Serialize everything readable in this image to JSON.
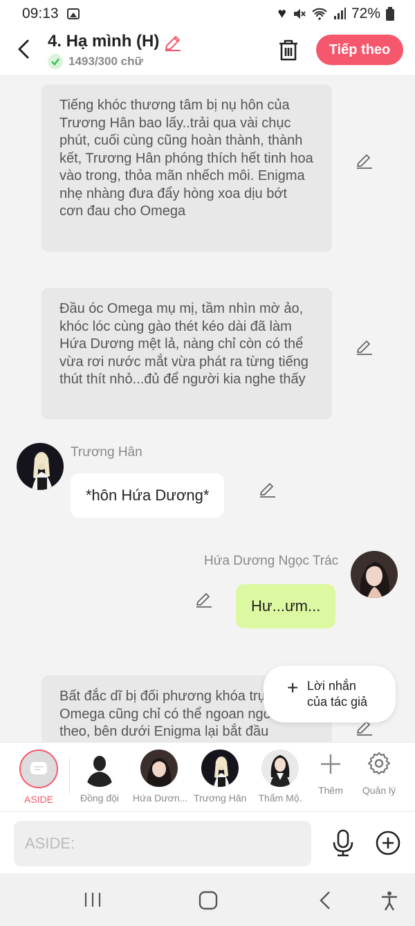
{
  "status_bar": {
    "time": "09:13",
    "battery": "72%",
    "icons": [
      "image-icon",
      "heart-icon",
      "mute-icon",
      "wifi-icon",
      "signal-icon",
      "battery-icon"
    ]
  },
  "header": {
    "title": "4. Hạ mình (H)",
    "word_count": "1493/300 chữ",
    "next_button": "Tiếp theo"
  },
  "chat": {
    "narration_1": "Tiếng khóc thương tâm bị nụ hôn của Trương Hân bao lấy..trải qua vài chục phút, cuối cùng cũng hoàn thành, thành kết, Trương Hân phóng thích hết tinh hoa vào trong, thỏa mãn nhếch môi. Enigma nhẹ nhàng đưa đẩy hòng xoa dịu bớt cơn đau cho Omega",
    "narration_2": "Đầu óc Omega mụ mị, tầm nhìn mờ ảo, khóc lóc cùng gào thét kéo dài đã làm Hứa Dương mệt lả, nàng chỉ còn có thể vừa rơi nước mắt vừa phát ra từng tiếng thút thít nhỏ...đủ để người kia nghe thấy",
    "msg_1": {
      "sender": "Trương Hân",
      "text": "*hôn Hứa Dương*"
    },
    "msg_2": {
      "sender": "Hứa Dương Ngọc Trác",
      "text": "Hư...ưm..."
    },
    "narration_3": "Bất đắc dĩ bị đối phương khóa trụ, Omega cũng chỉ có thể ngoan ngoãn làm theo, bên dưới Enigma lại bắt đầu"
  },
  "float_button": {
    "line1": "Lời nhắn",
    "line2": "của tác giả"
  },
  "character_bar": {
    "items": [
      {
        "label": "ASIDE"
      },
      {
        "label": "Đồng đội"
      },
      {
        "label": "Hứa Dươn..."
      },
      {
        "label": "Trương Hân"
      },
      {
        "label": "Thẩm Mộ."
      },
      {
        "label": "Thêm"
      },
      {
        "label": "Quản lý"
      }
    ]
  },
  "input": {
    "placeholder": "ASIDE:"
  },
  "colors": {
    "accent": "#f5576c",
    "own_bubble": "#dcf8a0",
    "narration_bg": "#e8e8e8",
    "check_green": "#3dbf57"
  }
}
